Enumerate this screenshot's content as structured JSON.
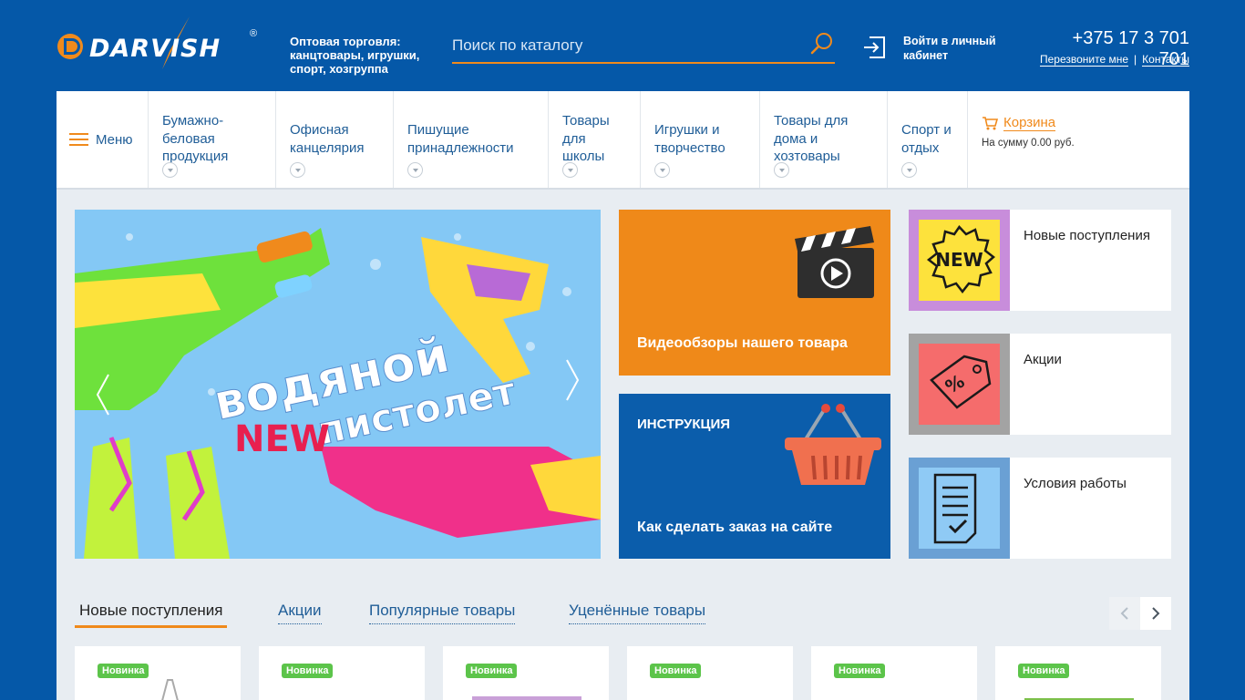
{
  "header": {
    "logo_text": "DARVISH",
    "logo_reg": "®",
    "tagline_line1": "Оптовая торговля:",
    "tagline_line2": "канцтовары, игрушки,",
    "tagline_line3": "спорт, хозгруппа",
    "search_placeholder": "Поиск по каталогу",
    "login_line1": "Войти в личный",
    "login_line2": "кабинет",
    "phone": "+375 17 3 701 701",
    "callback_label": "Перезвоните мне",
    "contacts_label": "Контакты",
    "link_separator": "|"
  },
  "nav": {
    "menu_label": "Меню",
    "items": [
      {
        "l1": "Бумажно-",
        "l2": "беловая",
        "l3": "продукция"
      },
      {
        "l1": "Офисная",
        "l2": "канцелярия",
        "l3": ""
      },
      {
        "l1": "Пишущие",
        "l2": "принадлежности",
        "l3": ""
      },
      {
        "l1": "Товары",
        "l2": "для",
        "l3": "школы"
      },
      {
        "l1": "Игрушки и",
        "l2": "творчество",
        "l3": ""
      },
      {
        "l1": "Товары для",
        "l2": "дома и",
        "l3": "хозтовары"
      },
      {
        "l1": "Спорт и",
        "l2": "отдых",
        "l3": ""
      }
    ],
    "cart_label": "Корзина",
    "cart_sum": "На сумму  0.00 руб."
  },
  "banner": {
    "line1": "водяной",
    "line2": "пистолет",
    "new_label": "NEW"
  },
  "tiles": {
    "video_caption": "Видеообзоры нашего товара",
    "instr_heading": "ИНСТРУКЦИЯ",
    "instr_caption": "Как сделать заказ на сайте",
    "side": [
      {
        "label": "Новые поступления",
        "bg": "#c88ddb",
        "icon": "new-badge-icon",
        "icon_text": "NEW"
      },
      {
        "label": "Акции",
        "bg": "#a3a3a3",
        "icon": "discount-tag-icon",
        "icon_text": "%"
      },
      {
        "label": "Условия работы",
        "bg": "#6aa0d4",
        "icon": "document-icon",
        "icon_text": ""
      }
    ]
  },
  "tabs": [
    {
      "label": "Новые поступления",
      "active": true
    },
    {
      "label": "Акции",
      "active": false
    },
    {
      "label": "Популярные товары",
      "active": false
    },
    {
      "label": "Уценённые товары",
      "active": false
    }
  ],
  "products": [
    {
      "badge": "Новинка"
    },
    {
      "badge": "Новинка"
    },
    {
      "badge": "Новинка"
    },
    {
      "badge": "Новинка"
    },
    {
      "badge": "Новинка"
    },
    {
      "badge": "Новинка"
    }
  ],
  "colors": {
    "brand_blue": "#0558a8",
    "accent_orange": "#f08a1c",
    "badge_green": "#5cc44a"
  }
}
